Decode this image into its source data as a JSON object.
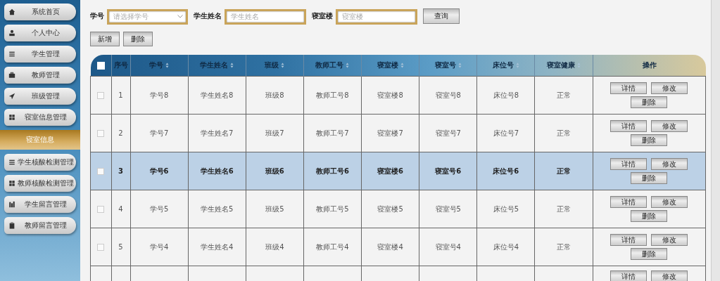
{
  "sidebar": {
    "items": [
      {
        "label": "系统首页",
        "selected": false
      },
      {
        "label": "个人中心",
        "selected": false
      },
      {
        "label": "学生管理",
        "selected": false
      },
      {
        "label": "教师管理",
        "selected": false
      },
      {
        "label": "班级管理",
        "selected": false
      },
      {
        "label": "寝室信息管理",
        "selected": false,
        "children": [
          {
            "label": "寝室信息",
            "selected": true
          }
        ]
      },
      {
        "label": "学生核酸检测管理",
        "selected": false
      },
      {
        "label": "教师核酸检测管理",
        "selected": false
      },
      {
        "label": "学生留言管理",
        "selected": false
      },
      {
        "label": "教师留言管理",
        "selected": false
      }
    ]
  },
  "search": {
    "fields": [
      {
        "label": "学号",
        "kind": "select",
        "placeholder": "请选择学号"
      },
      {
        "label": "学生姓名",
        "kind": "input",
        "placeholder": "学生姓名"
      },
      {
        "label": "寝室楼",
        "kind": "input",
        "placeholder": "寝室楼"
      }
    ],
    "button": "查询"
  },
  "toolbar": {
    "buttons": [
      "新增",
      "删除"
    ]
  },
  "table": {
    "all_selected": false,
    "columns": [
      {
        "label": "序号",
        "sortable": false
      },
      {
        "label": "学号",
        "sortable": true
      },
      {
        "label": "学生姓名",
        "sortable": true
      },
      {
        "label": "班级",
        "sortable": true
      },
      {
        "label": "教师工号",
        "sortable": true
      },
      {
        "label": "寝室楼",
        "sortable": true
      },
      {
        "label": "寝室号",
        "sortable": true
      },
      {
        "label": "床位号",
        "sortable": true
      },
      {
        "label": "寝室健康",
        "sortable": true
      },
      {
        "label": "操作",
        "sortable": false
      }
    ],
    "rows": [
      {
        "selected": false,
        "cells": [
          "1",
          "学号8",
          "学生姓名8",
          "班级8",
          "教师工号8",
          "寝室楼8",
          "寝室号8",
          "床位号8",
          "正常"
        ],
        "actions": [
          "详情",
          "修改",
          "删除"
        ]
      },
      {
        "selected": false,
        "cells": [
          "2",
          "学号7",
          "学生姓名7",
          "班级7",
          "教师工号7",
          "寝室楼7",
          "寝室号7",
          "床位号7",
          "正常"
        ],
        "actions": [
          "详情",
          "修改",
          "删除"
        ]
      },
      {
        "selected": true,
        "cells": [
          "3",
          "学号6",
          "学生姓名6",
          "班级6",
          "教师工号6",
          "寝室楼6",
          "寝室号6",
          "床位号6",
          "正常"
        ],
        "actions": [
          "详情",
          "修改",
          "删除"
        ]
      },
      {
        "selected": false,
        "cells": [
          "4",
          "学号5",
          "学生姓名5",
          "班级5",
          "教师工号5",
          "寝室楼5",
          "寝室号5",
          "床位号5",
          "正常"
        ],
        "actions": [
          "详情",
          "修改",
          "删除"
        ]
      },
      {
        "selected": false,
        "cells": [
          "5",
          "学号4",
          "学生姓名4",
          "班级4",
          "教师工号4",
          "寝室楼4",
          "寝室号4",
          "床位号4",
          "正常"
        ],
        "actions": [
          "详情",
          "修改",
          "删除"
        ]
      },
      {
        "selected": false,
        "actions": [
          "详情",
          "修改"
        ]
      }
    ]
  }
}
